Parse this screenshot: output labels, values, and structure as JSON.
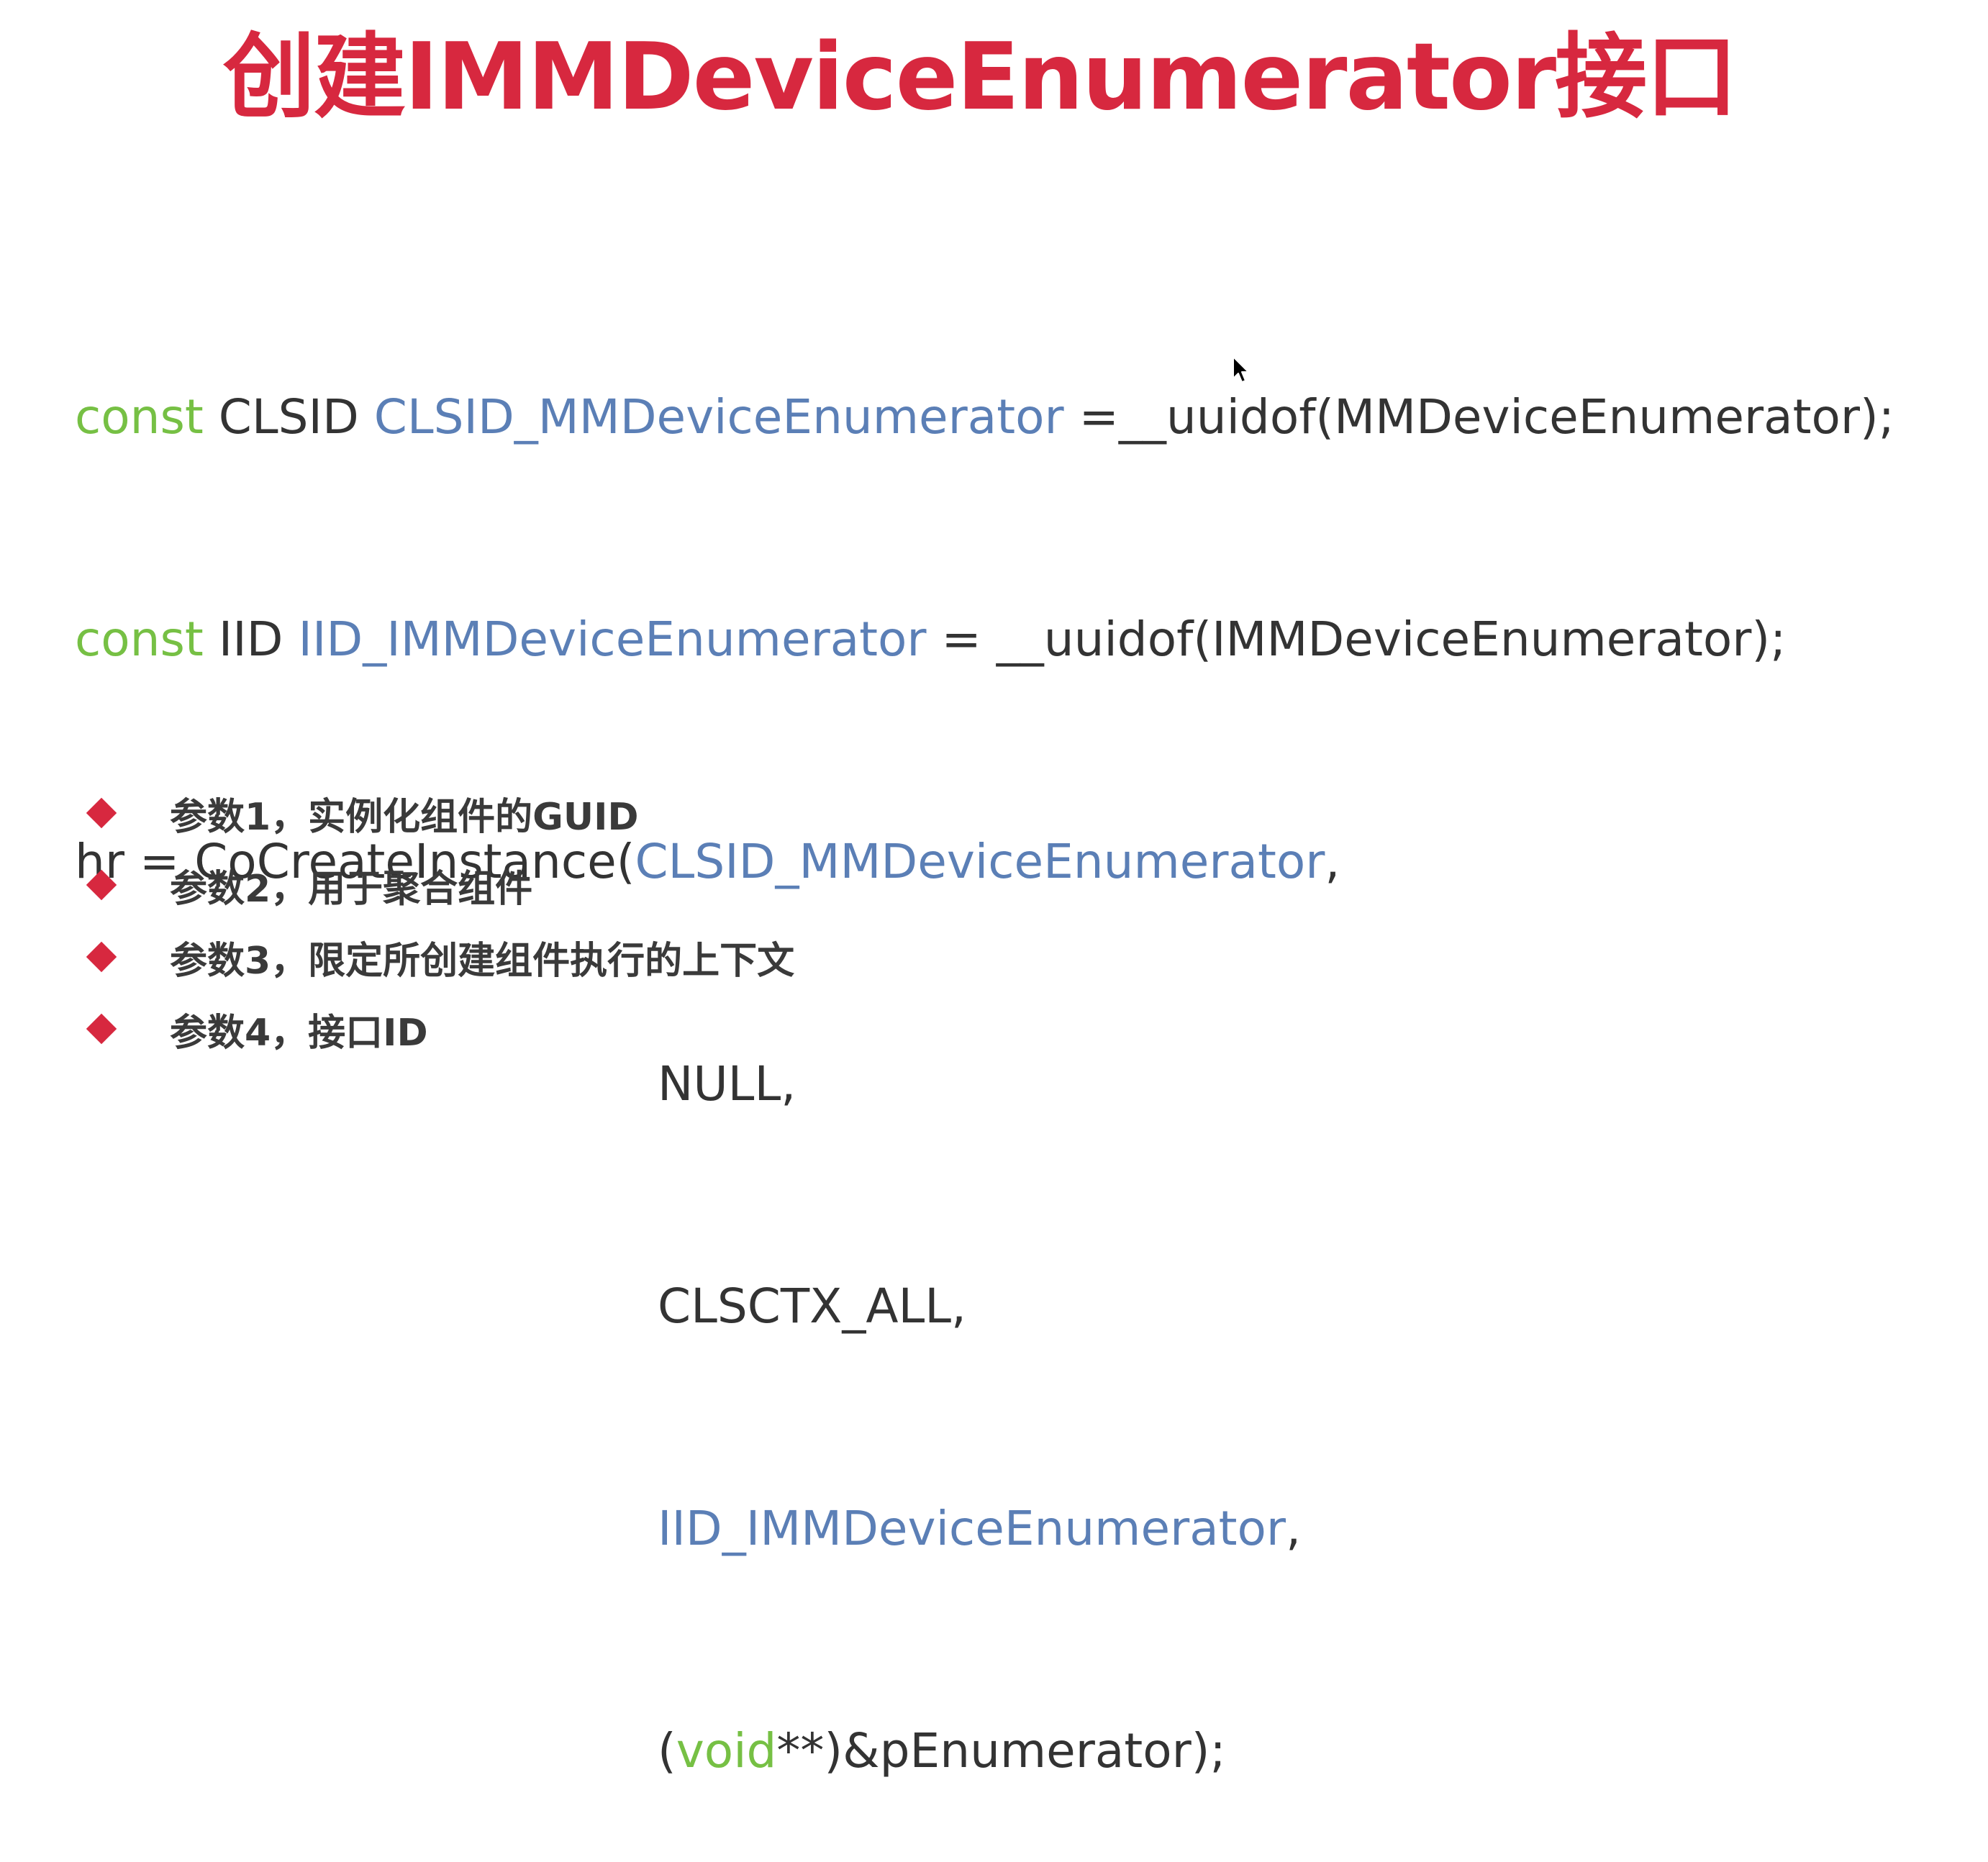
{
  "colors": {
    "title": "#d7283f",
    "keyword": "#76c044",
    "identifier": "#5b7fb6",
    "plain": "#333333",
    "bullet": "#d7283f",
    "bullet_text": "#3a3a3a"
  },
  "title": "创建IMMDeviceEnumerator接口",
  "code": {
    "line1": {
      "kw": "const",
      "type": " CLSID ",
      "name": "CLSID_MMDeviceEnumerator",
      "rest": " =__uuidof(MMDeviceEnumerator);"
    },
    "line2": {
      "kw": "const",
      "type": " IID ",
      "name": "IID_IMMDeviceEnumerator",
      "rest": " = __uuidof(IMMDeviceEnumerator);"
    },
    "line3": {
      "pre": "hr = CoCreateInstance(",
      "name": "CLSID_MMDeviceEnumerator",
      "post": ","
    },
    "line4": {
      "text": "NULL,"
    },
    "line5": {
      "text": "CLSCTX_ALL,"
    },
    "line6": {
      "name": "IID_IMMDeviceEnumerator",
      "post": ","
    },
    "line7": {
      "pre": "(",
      "kw": "void",
      "post": "**)&pEnumerator);"
    }
  },
  "bullets": [
    {
      "text": "参数1，实例化组件的GUID",
      "icon": "diamond-bullet-icon"
    },
    {
      "text": "参数2，用于聚合组件",
      "icon": "diamond-bullet-icon"
    },
    {
      "text": "参数3，限定所创建组件执行的上下文",
      "icon": "diamond-bullet-icon"
    },
    {
      "text": "参数4，接口ID",
      "icon": "diamond-bullet-icon"
    }
  ],
  "cursor_icon": "mouse-pointer-icon"
}
